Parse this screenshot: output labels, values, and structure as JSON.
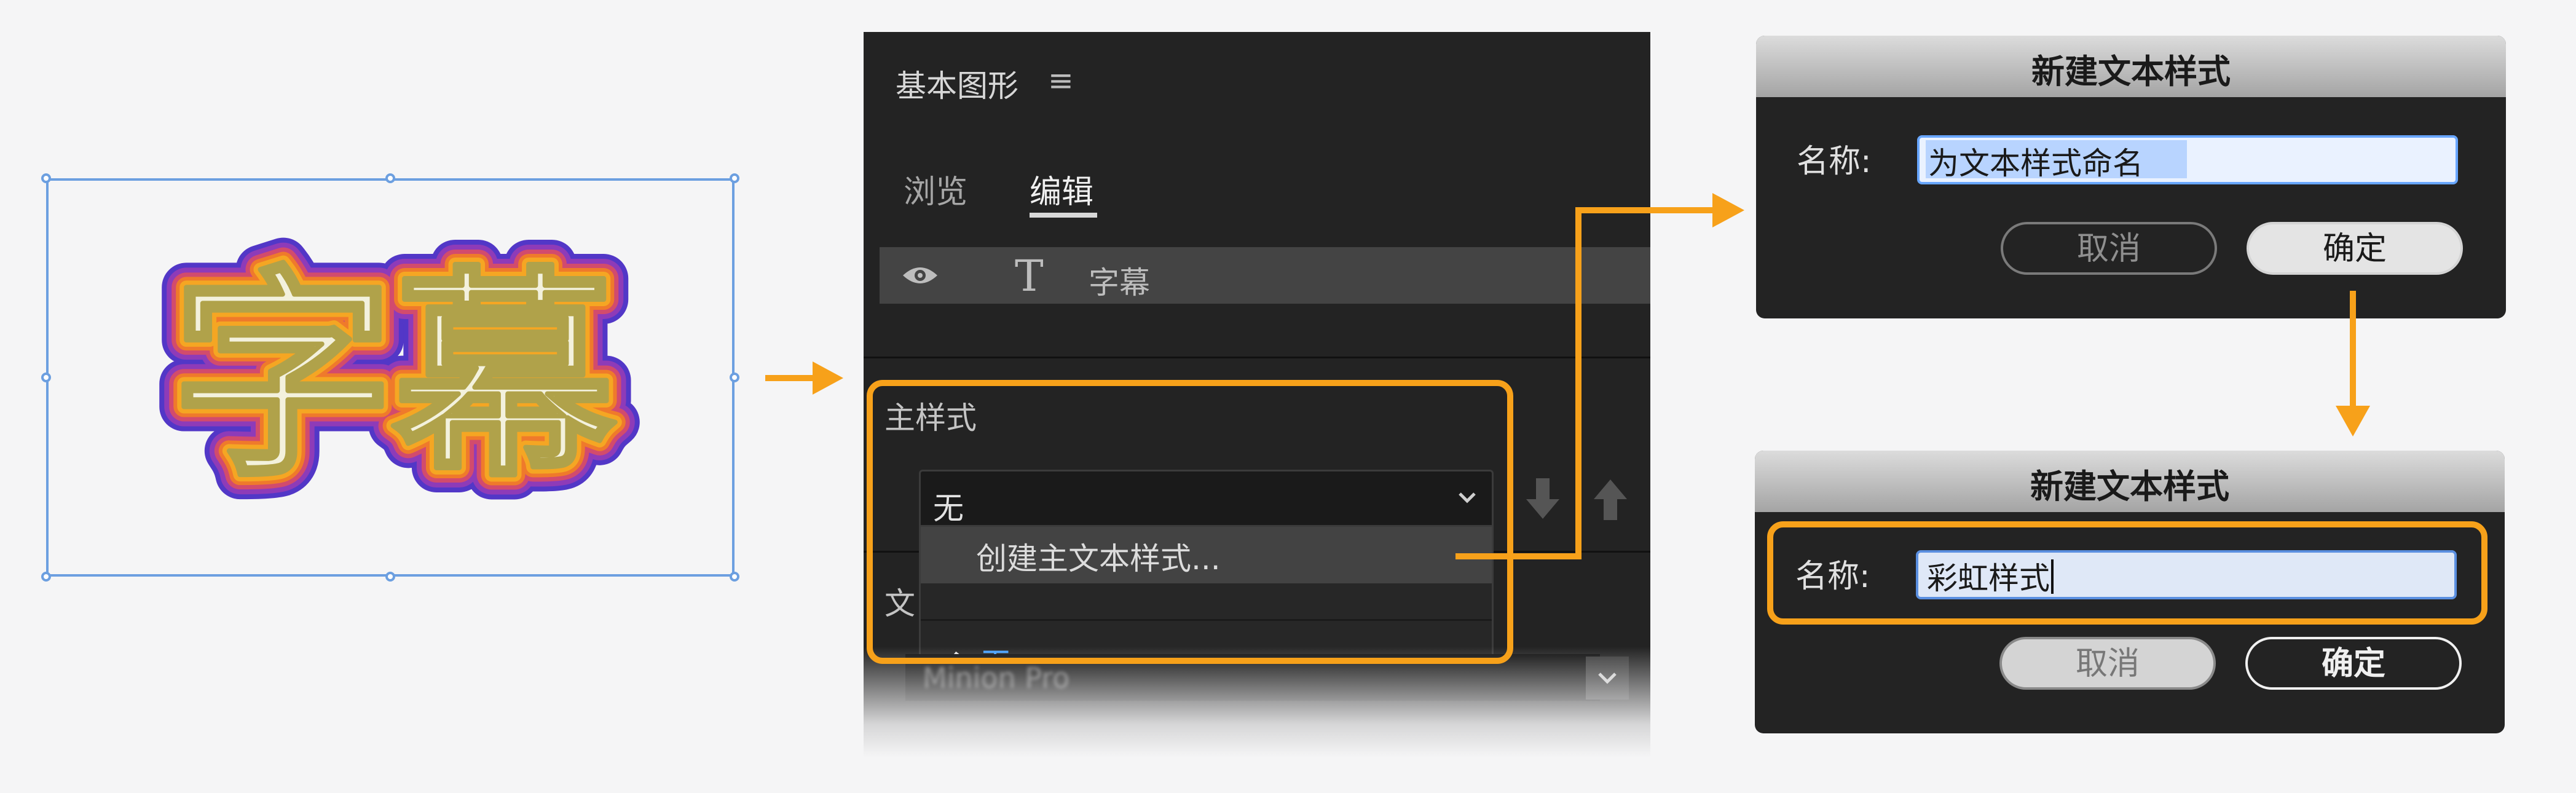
{
  "preview": {
    "text": "字幕"
  },
  "panel": {
    "title": "基本图形",
    "menu_icon": "hamburger-icon",
    "tabs": [
      "浏览",
      "编辑"
    ],
    "active_tab": "编辑",
    "layer": {
      "visibility_icon": "eye-icon",
      "type_icon": "text-T-icon",
      "name": "字幕"
    },
    "master_style": {
      "label": "主样式",
      "selected": "无",
      "push_icon": "arrow-down-icon",
      "pull_icon": "arrow-up-icon",
      "dropdown_items": [
        {
          "label": "创建主文本样式..."
        },
        {
          "label": "无",
          "checked": true
        }
      ]
    },
    "partial_label": "文",
    "font": "Minion Pro"
  },
  "dialog1": {
    "title": "新建文本样式",
    "name_label": "名称:",
    "name_value": "为文本样式命名",
    "cancel": "取消",
    "ok": "确定"
  },
  "dialog2": {
    "title": "新建文本样式",
    "name_label": "名称:",
    "name_value": "彩虹样式",
    "cancel": "取消",
    "ok": "确定"
  },
  "colors": {
    "highlight": "#f7a11a",
    "accent_blue": "#49a3ff",
    "selection_frame": "#6c9fe0"
  }
}
